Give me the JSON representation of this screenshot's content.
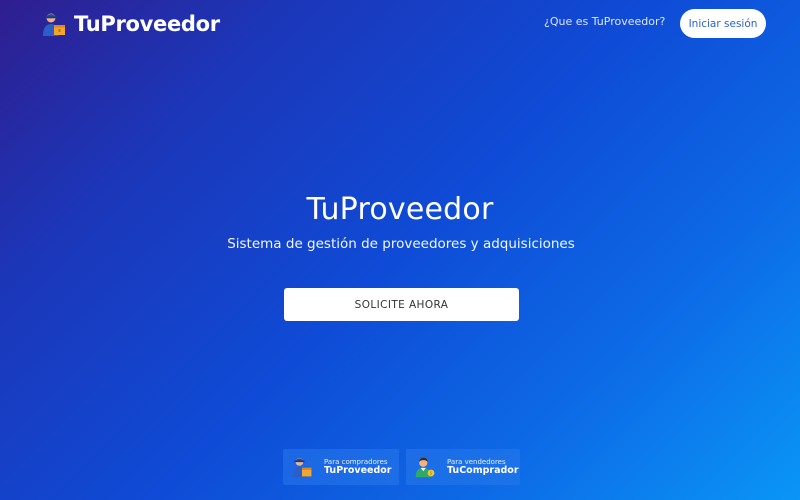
{
  "header": {
    "brand": "TuProveedor",
    "nav_link": "¿Que es TuProveedor?",
    "login_label": "Iniciar sesión"
  },
  "hero": {
    "title": "TuProveedor",
    "subtitle": "Sistema de gestión de proveedores y adquisiciones",
    "cta_label": "SOLICITE AHORA"
  },
  "cards": {
    "buyer": {
      "subtitle": "Para compradores",
      "name": "TuProveedor",
      "icon": "delivery-person-icon"
    },
    "seller": {
      "subtitle": "Para vendedores",
      "name": "TuComprador",
      "icon": "shopper-icon"
    }
  },
  "colors": {
    "accent": "#2a5fd8",
    "background_start": "#2f1e8f",
    "background_end": "#0a96f6"
  }
}
